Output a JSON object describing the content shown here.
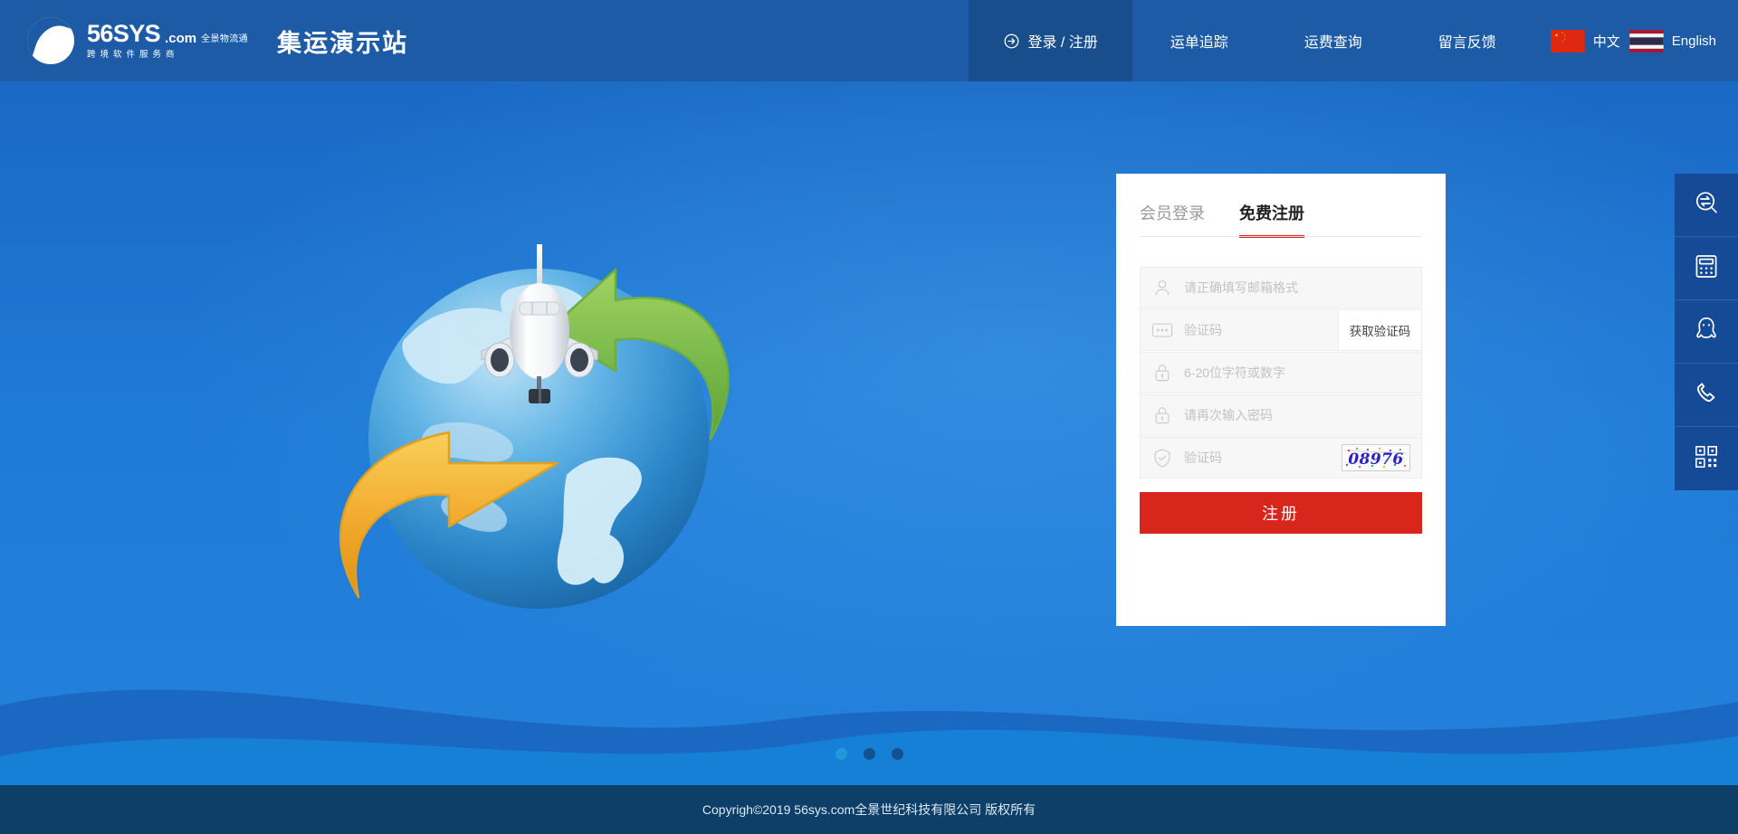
{
  "header": {
    "logo": {
      "brand": "56SYS",
      "domain": ".com",
      "sub_top": "全景物流通",
      "tagline": "跨境软件服务商",
      "logo_icon": "wave-sphere-logo-icon"
    },
    "site_title": "集运演示站",
    "nav": [
      {
        "label": "登录 / 注册",
        "icon": "login-arrow-circle-icon",
        "active": true
      },
      {
        "label": "运单追踪",
        "active": false
      },
      {
        "label": "运费查询",
        "active": false
      },
      {
        "label": "留言反馈",
        "active": false
      }
    ],
    "languages": [
      {
        "label": "中文",
        "flag": "china-flag-icon"
      },
      {
        "label": "English",
        "flag": "thailand-flag-icon"
      }
    ]
  },
  "banner": {
    "illustration": "globe-airplane-arrows-illustration",
    "dots": [
      {
        "active": true
      },
      {
        "active": false
      },
      {
        "active": false
      }
    ]
  },
  "card": {
    "tabs": [
      {
        "label": "会员登录",
        "active": false
      },
      {
        "label": "免费注册",
        "active": true
      }
    ],
    "fields": [
      {
        "name": "email",
        "icon": "user-icon",
        "placeholder": "请正确填写邮箱格式",
        "value": ""
      },
      {
        "name": "email-code",
        "icon": "message-dots-icon",
        "placeholder": "验证码",
        "value": ""
      },
      {
        "name": "password",
        "icon": "lock-icon",
        "placeholder": "6-20位字符或数字",
        "value": ""
      },
      {
        "name": "confirm-password",
        "icon": "lock-icon",
        "placeholder": "请再次输入密码",
        "value": ""
      },
      {
        "name": "captcha",
        "icon": "shield-check-icon",
        "placeholder": "验证码",
        "value": ""
      }
    ],
    "get_code_label": "获取验证码",
    "captcha_text": "08976",
    "submit_label": "注册"
  },
  "side_rail": [
    {
      "name": "tracking",
      "icon": "track-search-icon"
    },
    {
      "name": "calculator",
      "icon": "calculator-icon"
    },
    {
      "name": "qq-chat",
      "icon": "qq-penguin-icon"
    },
    {
      "name": "phone",
      "icon": "phone-icon"
    },
    {
      "name": "qrcode",
      "icon": "qrcode-icon"
    }
  ],
  "footer": {
    "copyright": "Copyrigh©2019 56sys.com全景世纪科技有限公司 版权所有"
  },
  "colors": {
    "header_bg": "#1d5ba6",
    "header_active": "#184e8c",
    "banner_blue": "#1f7ad6",
    "accent_red": "#d9261c",
    "footer_bg": "#0e3f68",
    "rail_bg": "#154a96"
  }
}
